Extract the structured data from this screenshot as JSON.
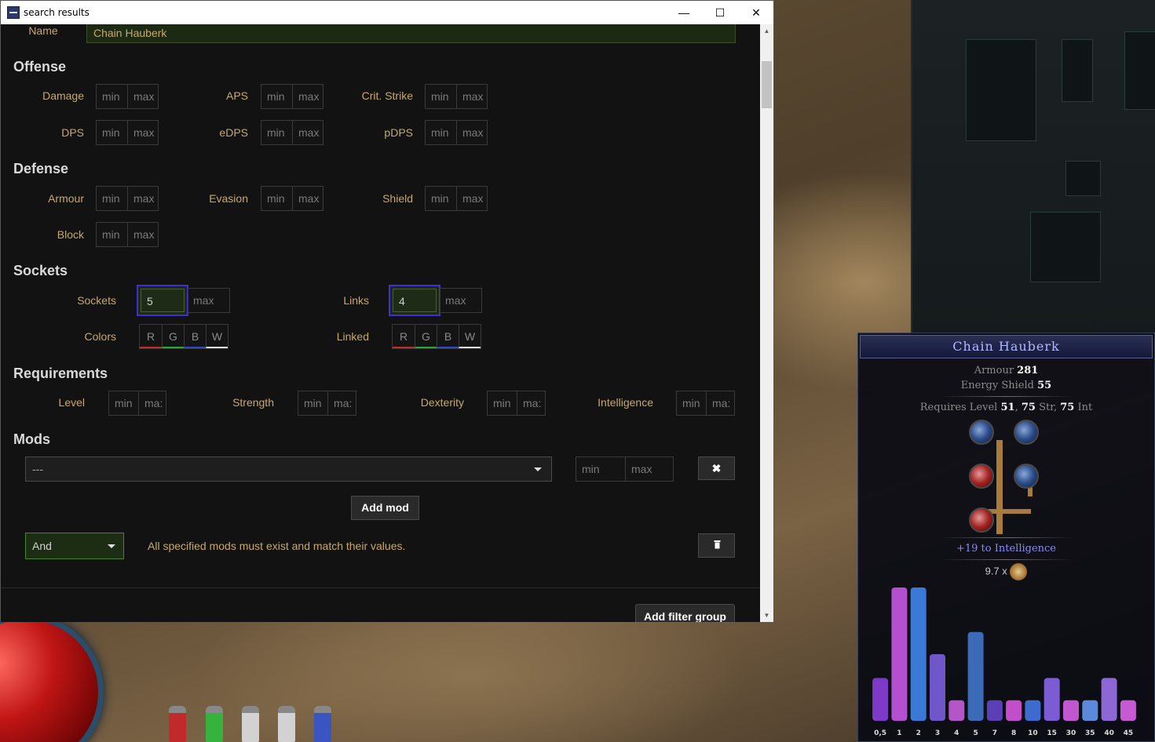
{
  "window": {
    "title": "search results",
    "controls": {
      "minimize": "—",
      "maximize": "☐",
      "close": "✕"
    }
  },
  "filters": {
    "name_label": "Name",
    "name_value": "Chain Hauberk",
    "min_placeholder": "min",
    "max_placeholder": "max",
    "offense": {
      "title": "Offense",
      "labels": [
        "Damage",
        "APS",
        "Crit. Strike",
        "DPS",
        "eDPS",
        "pDPS"
      ]
    },
    "defense": {
      "title": "Defense",
      "labels": [
        "Armour",
        "Evasion",
        "Shield",
        "Block"
      ]
    },
    "sockets": {
      "title": "Sockets",
      "sockets_label": "Sockets",
      "sockets_min": "5",
      "links_label": "Links",
      "links_min": "4",
      "colors_label": "Colors",
      "linked_label": "Linked",
      "color_letters": [
        "R",
        "G",
        "B",
        "W"
      ]
    },
    "requirements": {
      "title": "Requirements",
      "labels": [
        "Level",
        "Strength",
        "Dexterity",
        "Intelligence"
      ],
      "max_truncated": "ma:"
    },
    "mods": {
      "title": "Mods",
      "select_value": "---",
      "add_mod_label": "Add mod",
      "remove_icon": "✖",
      "group_type": "And",
      "group_description": "All specified mods must exist and match their values.",
      "delete_icon": "trash-icon",
      "add_filter_group_label": "Add filter group"
    }
  },
  "tooltip": {
    "item_name": "Chain Hauberk",
    "armour_label": "Armour",
    "armour_value": "281",
    "es_label": "Energy Shield",
    "es_value": "55",
    "requires_prefix": "Requires Level",
    "req_level": "51",
    "req_str": "75",
    "str_label": "Str",
    "req_int": "75",
    "int_label": "Int",
    "mod": "+19 to Intelligence",
    "price": "9.7 x"
  },
  "chart_data": {
    "type": "bar",
    "categories": [
      "0,5",
      "1",
      "2",
      "3",
      "4",
      "5",
      "7",
      "8",
      "10",
      "15",
      "30",
      "35",
      "40",
      "45"
    ],
    "series": [
      {
        "values": [
          27,
          84,
          84,
          42,
          13,
          56,
          13,
          13,
          13,
          27,
          13,
          13,
          27,
          13
        ]
      }
    ],
    "colors": [
      "#7d39c7",
      "#b54fd1",
      "#3a7ad6",
      "#7057c9",
      "#b455c8",
      "#3a6ab8",
      "#5a3fb5",
      "#c24fc9",
      "#3d6bd0",
      "#7b5cd5",
      "#c255d0",
      "#5a8ad9",
      "#8d67d6",
      "#c55ad2"
    ]
  }
}
